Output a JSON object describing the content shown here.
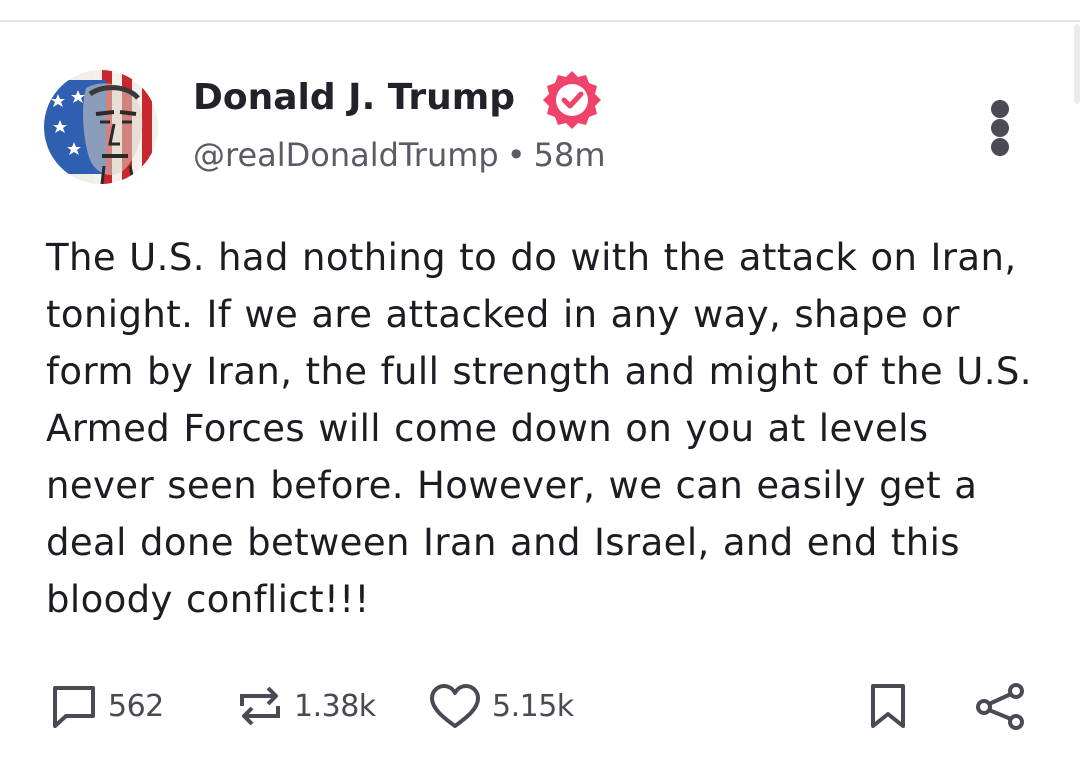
{
  "post": {
    "author": {
      "display_name": "Donald J. Trump",
      "handle": "@realDonaldTrump",
      "verified_icon": "verified-badge-icon",
      "avatar_icon": "avatar-image"
    },
    "separator": "•",
    "time_ago": "58m",
    "text": "The U.S. had nothing to do with the attack on Iran, tonight. If we are attacked in any way, shape or form by Iran, the full strength and might of the U.S. Armed Forces will come down on you at levels never seen before. However, we can easily get a deal done between Iran and Israel, and end this bloody conflict!!!",
    "actions": {
      "replies": "562",
      "reposts": "1.38k",
      "likes": "5.15k"
    }
  },
  "colors": {
    "verified": "#f0436a",
    "text": "#1c1c22",
    "muted": "#5b5b66",
    "icon": "#4a4a54"
  }
}
